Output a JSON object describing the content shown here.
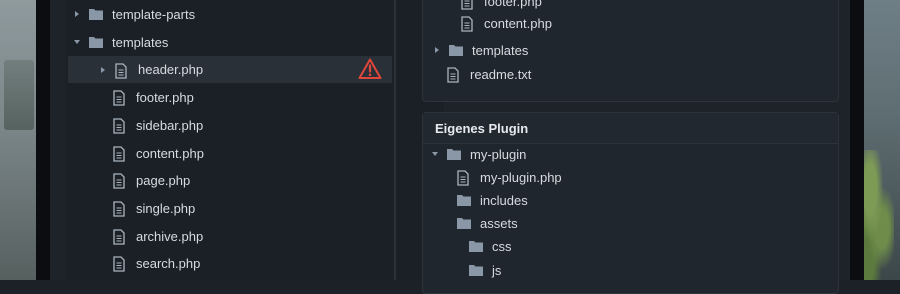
{
  "left_tree": [
    {
      "label": "template-parts",
      "type": "folder",
      "expanded": false
    },
    {
      "label": "templates",
      "type": "folder",
      "expanded": true
    },
    {
      "label": "header.php",
      "type": "file",
      "selected": true,
      "warning": true
    },
    {
      "label": "footer.php",
      "type": "file"
    },
    {
      "label": "sidebar.php",
      "type": "file"
    },
    {
      "label": "content.php",
      "type": "file"
    },
    {
      "label": "page.php",
      "type": "file"
    },
    {
      "label": "single.php",
      "type": "file"
    },
    {
      "label": "archive.php",
      "type": "file"
    },
    {
      "label": "search.php",
      "type": "file"
    }
  ],
  "right_top_tree": [
    {
      "label": "footer.php",
      "type": "file"
    },
    {
      "label": "content.php",
      "type": "file"
    },
    {
      "label": "templates",
      "type": "folder",
      "expanded": false
    },
    {
      "label": "readme.txt",
      "type": "file"
    }
  ],
  "plugin_panel": {
    "title": "Eigenes Plugin",
    "tree": [
      {
        "label": "my-plugin",
        "type": "folder",
        "expanded": true
      },
      {
        "label": "my-plugin.php",
        "type": "file"
      },
      {
        "label": "includes",
        "type": "folder"
      },
      {
        "label": "assets",
        "type": "folder"
      },
      {
        "label": "css",
        "type": "folder"
      },
      {
        "label": "js",
        "type": "folder"
      }
    ]
  },
  "colors": {
    "folder": "#8a97a6",
    "file": "#aab4bf",
    "warning": "#e0463c",
    "text": "#d6dbe2",
    "selected_row": "#2a3038"
  },
  "icons": {
    "folder": "folder-icon",
    "file": "file-icon",
    "warning": "warning-icon",
    "collapsed": "chevron-right-icon",
    "expanded": "chevron-down-icon"
  }
}
